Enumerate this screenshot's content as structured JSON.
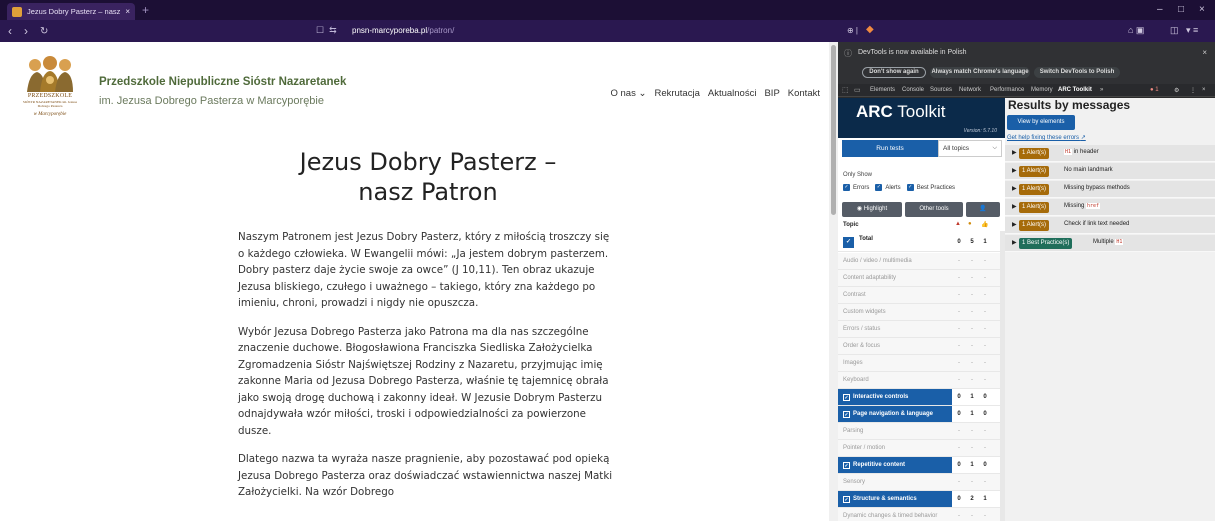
{
  "browser": {
    "tab_title": "Jezus Dobry Pasterz – nasz Patro",
    "tab_close": "×",
    "new_tab": "+",
    "win_min": "–",
    "win_max": "□",
    "win_close": "×",
    "nav_back": "‹",
    "nav_fwd": "›",
    "nav_reload": "↻",
    "url_host": "pnsn-marcyporeba.pl",
    "url_path": "/patron/"
  },
  "site": {
    "logo_line1": "PRZEDSZKOLE",
    "logo_line2": "SIÓSTR NAZARETANEK im. Jezusa Dobrego Pasterza",
    "logo_line3": "w Marcyporębie",
    "title": "Przedszkole Niepubliczne Sióstr Nazaretanek",
    "subtitle": "im. Jezusa Dobrego Pasterza w Marcyporębie",
    "nav": [
      "O nas ⌄",
      "Rekrutacja",
      "Aktualności",
      "BIP",
      "Kontakt"
    ],
    "heading_line1": "Jezus Dobry Pasterz –",
    "heading_line2": "nasz Patron",
    "paragraphs": [
      "Naszym Patronem jest Jezus Dobry Pasterz, który z miłością troszczy się o każdego człowieka. W Ewangelii mówi: „Ja jestem dobrym pasterzem. Dobry pasterz daje życie swoje za owce” (J 10,11). Ten obraz ukazuje Jezusa bliskiego, czułego i uważnego – takiego, który zna każdego po imieniu, chroni, prowadzi i nigdy nie opuszcza.",
      "Wybór Jezusa Dobrego Pasterza jako Patrona ma dla nas szczególne znaczenie duchowe. Błogosławiona Franciszka Siedliska Założycielka Zgromadzenia Sióstr Najświętszej Rodziny z Nazaretu, przyjmując imię zakonne Maria od Jezusa Dobrego Pasterza, właśnie tę tajemnicę obrała jako swoją drogę duchową i zakonny ideał. W Jezusie Dobrym Pasterzu odnajdywała wzór miłości, troski i odpowiedzialności za powierzone dusze.",
      "Dlatego nazwa ta wyraża nasze pragnienie, aby pozostawać pod opieką Jezusa Dobrego Pasterza oraz doświadczać wstawiennictwa naszej Matki Założycielki. Na wzór Dobrego"
    ]
  },
  "devtools": {
    "info_icon": "ⓘ",
    "info_text": "DevTools is now available in Polish",
    "info_close": "×",
    "btn_dont_show": "Don't show again",
    "btn_match": "Always match Chrome's language",
    "btn_switch": "Switch DevTools to Polish",
    "tabs": [
      "Elements",
      "Console",
      "Sources",
      "Network",
      "Performance",
      "Memory",
      "ARC Toolkit",
      "»"
    ],
    "error_count": "1",
    "tab_icon_gear": "⚙",
    "tab_icon_more": "⋮",
    "tab_icon_close": "×"
  },
  "arc": {
    "logo_bold": "ARC",
    "logo_light": " Toolkit",
    "version": "Version: 5.7.10",
    "run_tests": "Run tests",
    "topics_value": "All topics",
    "topics_chevron": "⌵",
    "only_show": "Only Show",
    "filters": [
      "Errors",
      "Alerts",
      "Best Practices"
    ],
    "highlight": "◉ Highlight",
    "other_tools": "Other tools",
    "user_icon": "👤",
    "topic_label": "Topic",
    "col_error": "▲",
    "col_alert": "●",
    "col_bp": "👍",
    "check": "✓",
    "topics": [
      {
        "name": "Total",
        "e": "0",
        "a": "5",
        "b": "1"
      },
      {
        "name": "Audio / video / multimedia",
        "e": "-",
        "a": "-",
        "b": "-"
      },
      {
        "name": "Content adaptability",
        "e": "-",
        "a": "-",
        "b": "-"
      },
      {
        "name": "Contrast",
        "e": "-",
        "a": "-",
        "b": "-"
      },
      {
        "name": "Custom widgets",
        "e": "-",
        "a": "-",
        "b": "-"
      },
      {
        "name": "Errors / status",
        "e": "-",
        "a": "-",
        "b": "-"
      },
      {
        "name": "Order & focus",
        "e": "-",
        "a": "-",
        "b": "-"
      },
      {
        "name": "Images",
        "e": "-",
        "a": "-",
        "b": "-"
      },
      {
        "name": "Keyboard",
        "e": "-",
        "a": "-",
        "b": "-"
      },
      {
        "name": "Interactive controls",
        "e": "0",
        "a": "1",
        "b": "0"
      },
      {
        "name": "Page navigation & language",
        "e": "0",
        "a": "1",
        "b": "0"
      },
      {
        "name": "Parsing",
        "e": "-",
        "a": "-",
        "b": "-"
      },
      {
        "name": "Pointer / motion",
        "e": "-",
        "a": "-",
        "b": "-"
      },
      {
        "name": "Repetitive content",
        "e": "0",
        "a": "1",
        "b": "0"
      },
      {
        "name": "Sensory",
        "e": "-",
        "a": "-",
        "b": "-"
      },
      {
        "name": "Structure & semantics",
        "e": "0",
        "a": "2",
        "b": "1"
      },
      {
        "name": "Dynamic changes & timed behavior",
        "e": "-",
        "a": "-",
        "b": "-"
      }
    ]
  },
  "results": {
    "title": "Results by messages",
    "view_btn": "View by elements",
    "help_link": "Get help fixing these errors",
    "help_icon": "↗",
    "triangle": "▶",
    "rows": [
      {
        "badge": "1 Alert(s)",
        "pre": "",
        "code": "H1",
        "post": " in header"
      },
      {
        "badge": "1 Alert(s)",
        "pre": "No main landmark",
        "code": "",
        "post": ""
      },
      {
        "badge": "1 Alert(s)",
        "pre": "Missing bypass methods",
        "code": "",
        "post": ""
      },
      {
        "badge": "1 Alert(s)",
        "pre": "Missing ",
        "code": "href",
        "post": ""
      },
      {
        "badge": "1 Alert(s)",
        "pre": "Check if link text needed",
        "code": "",
        "post": ""
      },
      {
        "badge": "1 Best Practice(s)",
        "pre": "Multiple ",
        "code": "H1",
        "post": ""
      }
    ]
  },
  "colors": {
    "chrome_bg": "#1c0f35",
    "arc_header": "#0b2a4a",
    "arc_blue": "#1a5fa8",
    "alert_badge": "#a66b0a",
    "bp_badge": "#1f6e5a",
    "site_title": "#4f6a3a"
  }
}
